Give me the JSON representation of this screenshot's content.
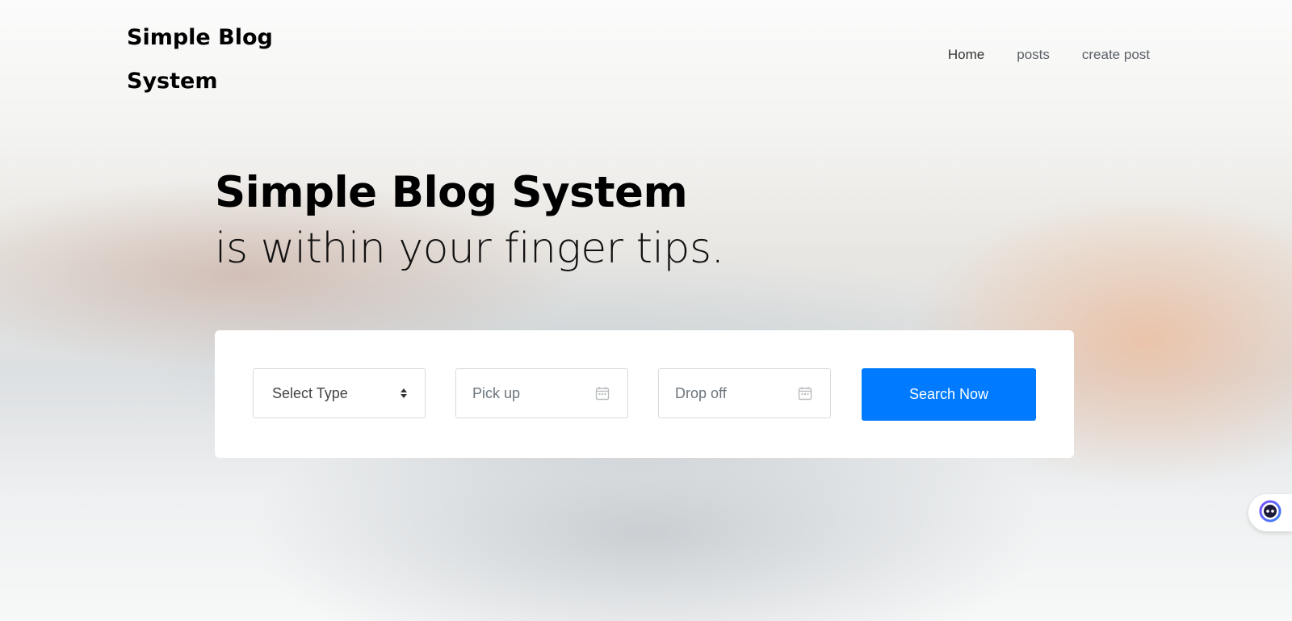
{
  "brand": {
    "name": "Simple Blog System"
  },
  "nav": {
    "items": [
      "Home",
      "posts",
      "create post"
    ]
  },
  "hero": {
    "title": "Simple Blog System",
    "subtitle": "is within your finger tips."
  },
  "search": {
    "type_select": {
      "selected": "Select Type",
      "icon": "sort-arrows-icon"
    },
    "pickup": {
      "placeholder": "Pick up",
      "icon": "calendar-icon"
    },
    "dropoff": {
      "placeholder": "Drop off",
      "icon": "calendar-icon"
    },
    "button_label": "Search Now"
  },
  "colors": {
    "primary": "#007bff",
    "card": "#ffffff",
    "text": "#000000"
  },
  "floating": {
    "icon": "assistant-face-icon"
  }
}
